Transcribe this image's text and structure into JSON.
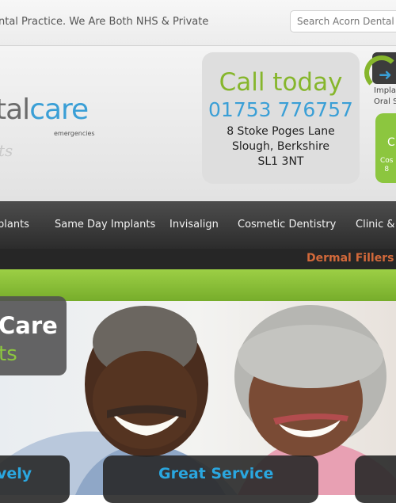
{
  "topbar": {
    "tagline": "ntal Practice. We Are Both NHS & Private",
    "search_placeholder": "Search Acorn Dental C"
  },
  "logo": {
    "part1": "tal",
    "part2": "care",
    "sub": "emergencies",
    "ghost": "ts"
  },
  "callbox": {
    "title": "Call today",
    "phone": "01753 776757",
    "address": [
      "8 Stoke Poges Lane",
      "Slough, Berkshire",
      "SL1 3NT"
    ]
  },
  "badge": {
    "icon": "implants-arrow-icon",
    "text_line1": "Impla",
    "text_line2": "Oral S"
  },
  "greenbox": {
    "title": "C",
    "line1": "Cos",
    "line2": "8"
  },
  "nav": {
    "items": [
      "plants",
      "Same Day Implants",
      "Invisalign",
      "Cosmetic Dentistry",
      "Clinic &"
    ]
  },
  "subnav": {
    "item": "Dermal Fillers"
  },
  "hero": {
    "caption_line1": "Care",
    "caption_line2": "ts"
  },
  "panels": [
    "vely",
    "Great Service"
  ],
  "colors": {
    "green": "#86b62c",
    "blue": "#3a9fd6",
    "nav": "#333333",
    "orange": "#d2693a"
  }
}
